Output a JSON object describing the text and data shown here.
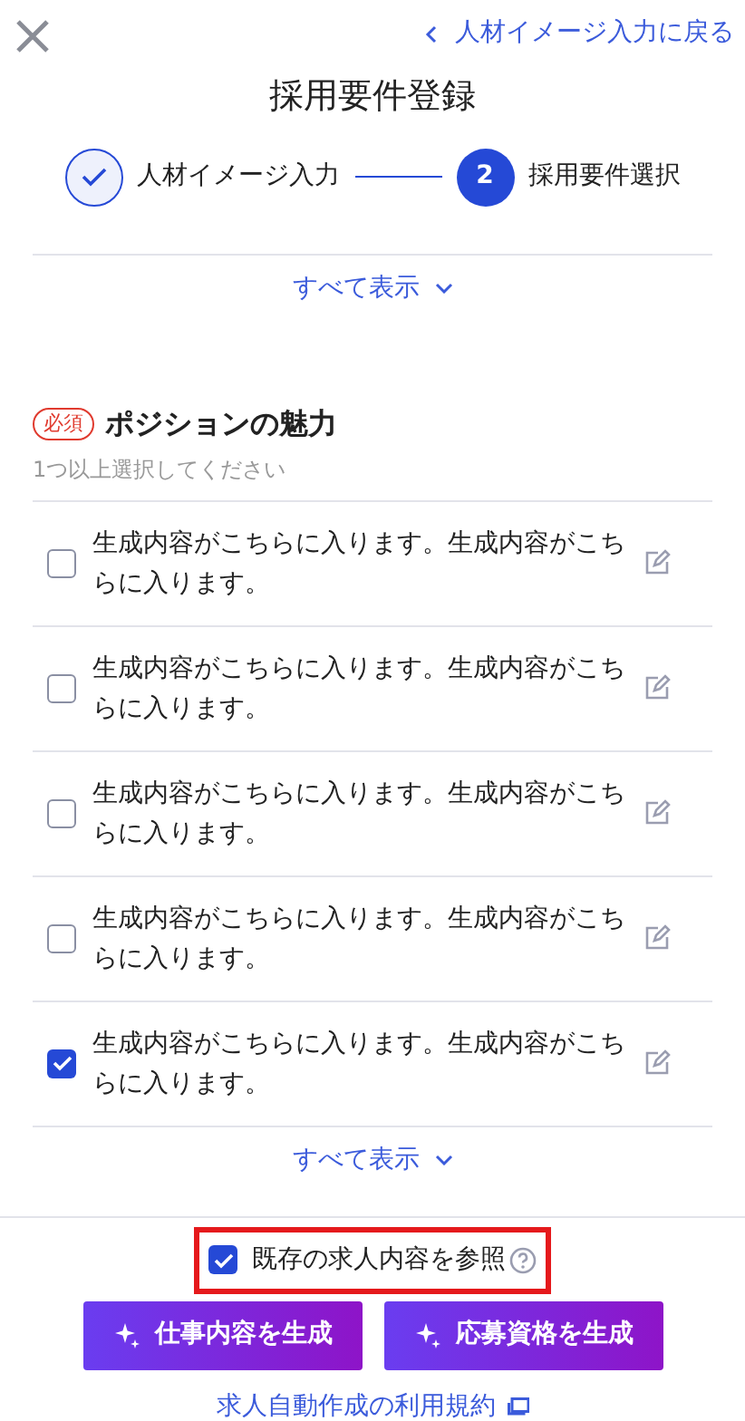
{
  "header": {
    "back_link": "人材イメージ入力に戻る",
    "title": "採用要件登録",
    "steps": [
      {
        "label": "人材イメージ入力",
        "done": true,
        "selected": false
      },
      {
        "label": "採用要件選択",
        "number": "2",
        "done": false,
        "selected": true
      }
    ]
  },
  "prev_section": {
    "show_all": "すべて表示"
  },
  "section": {
    "required_badge": "必須",
    "title": "ポジションの魅力",
    "hint": "1つ以上選択してください",
    "options": [
      {
        "text": "生成内容がこちらに入ります。生成内容がこちらに入ります。",
        "checked": false
      },
      {
        "text": "生成内容がこちらに入ります。生成内容がこちらに入ります。",
        "checked": false
      },
      {
        "text": "生成内容がこちらに入ります。生成内容がこちらに入ります。",
        "checked": false
      },
      {
        "text": "生成内容がこちらに入ります。生成内容がこちらに入ります。",
        "checked": false
      },
      {
        "text": "生成内容がこちらに入ります。生成内容がこちらに入ります。",
        "checked": true
      }
    ],
    "show_all": "すべて表示"
  },
  "footer": {
    "reference": {
      "label": "既存の求人内容を参照",
      "checked": true
    },
    "buttons": [
      "仕事内容を生成",
      "応募資格を生成"
    ],
    "terms_link": "求人自動作成の利用規約"
  }
}
